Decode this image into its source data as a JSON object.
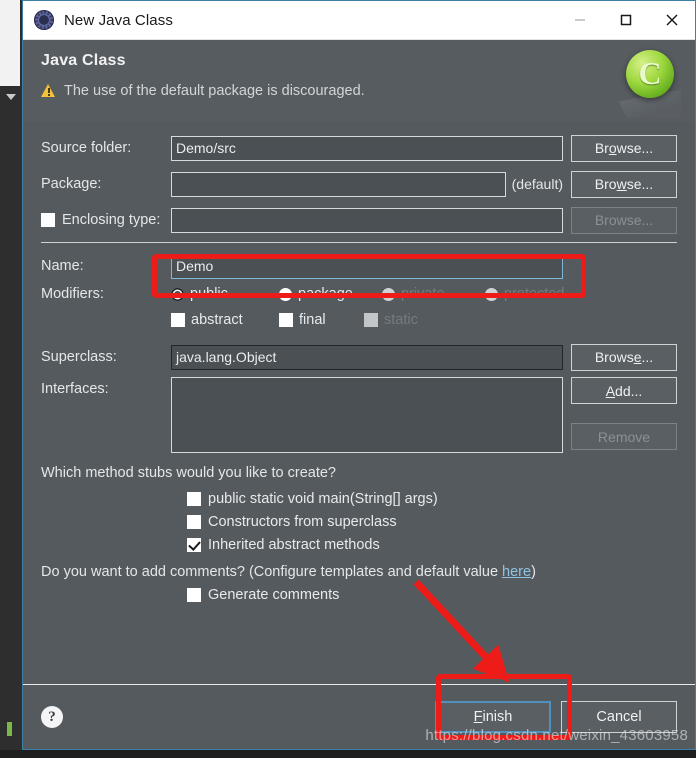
{
  "window": {
    "title": "New Java Class",
    "icon": "java-class-gear-icon",
    "controls": {
      "minimize": "minimize-icon",
      "maximize": "maximize-icon",
      "close": "close-icon"
    }
  },
  "header": {
    "title": "Java Class",
    "message": "The use of the default package is discouraged.",
    "message_icon": "warning-triangle-icon",
    "badge_letter": "C",
    "badge_color": "#8ccc32"
  },
  "form": {
    "source_folder": {
      "label": "Source folder:",
      "value": "Demo/src",
      "browse": "Browse..."
    },
    "package": {
      "label": "Package:",
      "value": "",
      "default_tag": "(default)",
      "browse": "Browse..."
    },
    "enclosing_type": {
      "label": "Enclosing type:",
      "checked": false,
      "value": "",
      "browse": "Browse..."
    },
    "name": {
      "label": "Name:",
      "value": "Demo"
    },
    "modifiers": {
      "label": "Modifiers:",
      "radios": [
        {
          "label": "public",
          "selected": true,
          "enabled": true
        },
        {
          "label": "package",
          "selected": false,
          "enabled": true
        },
        {
          "label": "private",
          "selected": false,
          "enabled": false
        },
        {
          "label": "protected",
          "selected": false,
          "enabled": false
        }
      ],
      "checks": [
        {
          "label": "abstract",
          "checked": false,
          "enabled": true
        },
        {
          "label": "final",
          "checked": false,
          "enabled": true
        },
        {
          "label": "static",
          "checked": false,
          "enabled": false
        }
      ]
    },
    "superclass": {
      "label": "Superclass:",
      "value": "java.lang.Object",
      "browse": "Browse..."
    },
    "interfaces": {
      "label": "Interfaces:",
      "items": [],
      "add": "Add...",
      "remove": "Remove"
    },
    "stubs": {
      "question": "Which method stubs would you like to create?",
      "items": [
        {
          "label": "public static void main(String[] args)",
          "checked": false
        },
        {
          "label": "Constructors from superclass",
          "checked": false
        },
        {
          "label": "Inherited abstract methods",
          "checked": true
        }
      ]
    },
    "comments": {
      "question_prefix": "Do you want to add comments? (Configure templates and default value ",
      "link": "here",
      "question_suffix": ")",
      "checkbox": {
        "label": "Generate comments",
        "checked": false
      }
    }
  },
  "footer": {
    "help": "?",
    "finish": "Finish",
    "cancel": "Cancel"
  },
  "annotations": {
    "highlight_color": "#ee1c18",
    "watermark": "https://blog.csdn.net/weixin_43603958"
  }
}
